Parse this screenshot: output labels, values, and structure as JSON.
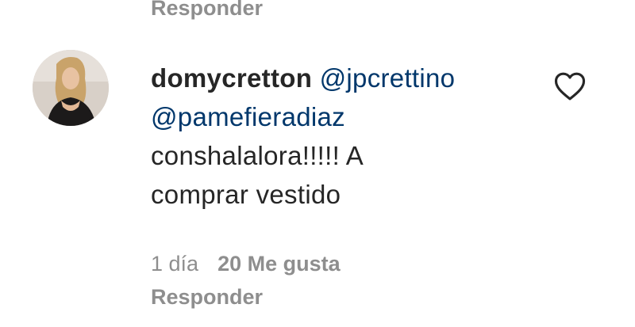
{
  "previous_comment": {
    "reply_label": "Responder"
  },
  "comment": {
    "username": "domycretton",
    "mentions": [
      "@jpcrettino",
      "@pamefieradiaz"
    ],
    "text_line1": "conshalalora!!!!! A",
    "text_line2": "comprar vestido",
    "age": "1 día",
    "likes": "20 Me gusta",
    "reply_label": "Responder",
    "like_icon": "heart-outline-icon"
  },
  "colors": {
    "text": "#262626",
    "mention": "#00376b",
    "muted": "#8e8e8e",
    "background": "#ffffff"
  }
}
